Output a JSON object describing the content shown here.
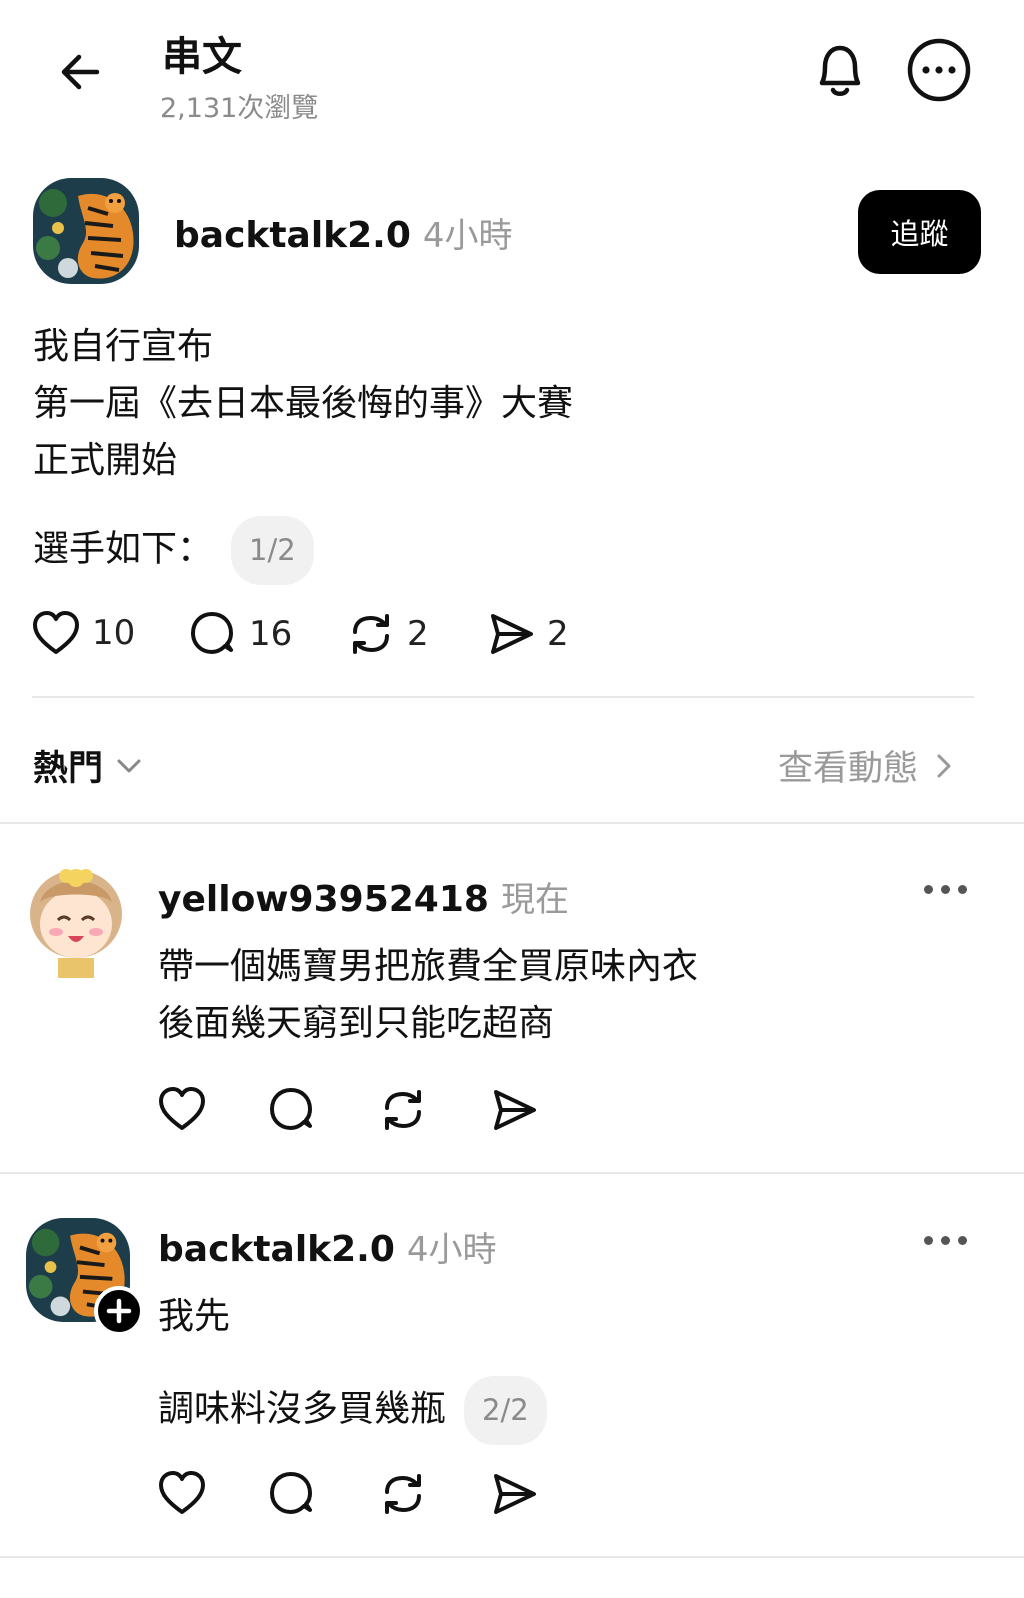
{
  "header": {
    "title": "串文",
    "views": "2,131次瀏覽"
  },
  "post": {
    "username": "backtalk2.0",
    "time": "4小時",
    "follow_label": "追蹤",
    "lines": [
      "我自行宣布",
      "第一屆《去日本最後悔的事》大賽",
      "正式開始"
    ],
    "second_paragraph": "選手如下：",
    "page_indicator": "1/2",
    "actions": {
      "likes": "10",
      "comments": "16",
      "reposts": "2",
      "shares": "2"
    }
  },
  "sort_bar": {
    "sort_label": "熱門",
    "view_activity_label": "查看動態"
  },
  "replies": [
    {
      "username": "yellow93952418",
      "time": "現在",
      "lines": [
        "帶一個媽寶男把旅費全買原味內衣",
        "後面幾天窮到只能吃超商"
      ]
    },
    {
      "username": "backtalk2.0",
      "time": "4小時",
      "line1": "我先",
      "line2": "調味料沒多買幾瓶",
      "page_indicator": "2/2"
    }
  ],
  "icons": {
    "back": "arrow-left-icon",
    "bell": "bell-icon",
    "more": "more-circle-icon",
    "heart": "heart-icon",
    "comment": "comment-icon",
    "repost": "repost-icon",
    "share": "send-icon",
    "chevron_down": "chevron-down-icon",
    "chevron_right": "chevron-right-icon",
    "plus": "plus-badge-icon"
  },
  "colors": {
    "primary_text": "#111111",
    "secondary_text": "#8a8a8a",
    "divider": "#e7e7e7",
    "button_bg": "#000000"
  }
}
